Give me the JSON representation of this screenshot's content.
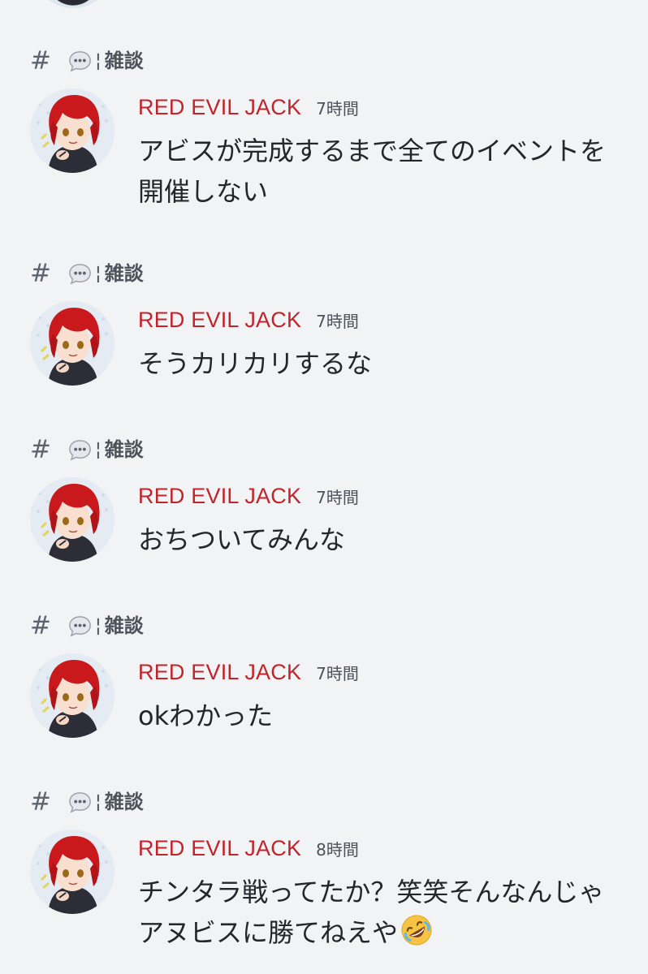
{
  "results": [
    {
      "channel": {
        "hash": "#",
        "separator": "¦",
        "name": "雑談",
        "icon": "speech-bubble-icon"
      },
      "author": "RED EVIL JACK",
      "time": "7時間",
      "text": "アビスが完成するまで全てのイベントを開催しない",
      "emoji": null
    },
    {
      "channel": {
        "hash": "#",
        "separator": "¦",
        "name": "雑談",
        "icon": "speech-bubble-icon"
      },
      "author": "RED EVIL JACK",
      "time": "7時間",
      "text": "そうカリカリするな",
      "emoji": null
    },
    {
      "channel": {
        "hash": "#",
        "separator": "¦",
        "name": "雑談",
        "icon": "speech-bubble-icon"
      },
      "author": "RED EVIL JACK",
      "time": "7時間",
      "text": "おちついてみんな",
      "emoji": null
    },
    {
      "channel": {
        "hash": "#",
        "separator": "¦",
        "name": "雑談",
        "icon": "speech-bubble-icon"
      },
      "author": "RED EVIL JACK",
      "time": "7時間",
      "text": "okわかった",
      "emoji": null
    },
    {
      "channel": {
        "hash": "#",
        "separator": "¦",
        "name": "雑談",
        "icon": "speech-bubble-icon"
      },
      "author": "RED EVIL JACK",
      "time": "8時間",
      "text": "チンタラ戦ってたか？笑笑そんなんじゃアヌビスに勝てねえや",
      "emoji": "rolling-on-floor-laughing-icon"
    }
  ],
  "colors": {
    "background": "#f2f3f5",
    "username": "#c3232b",
    "text": "#23262b",
    "muted": "#4b525b"
  }
}
